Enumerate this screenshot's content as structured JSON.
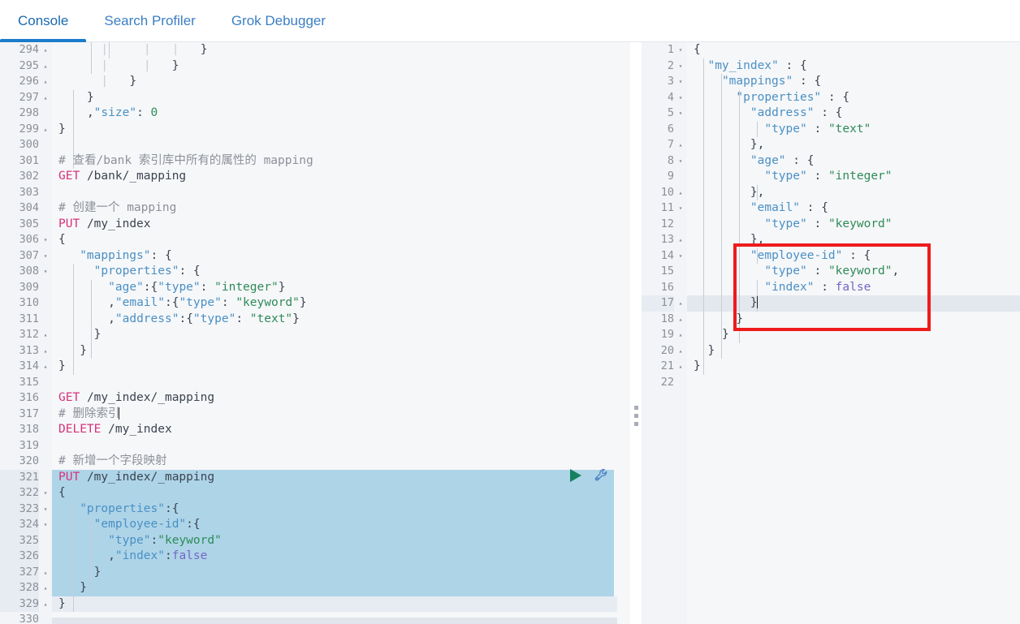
{
  "tabs": [
    {
      "label": "Console",
      "active": true
    },
    {
      "label": "Search Profiler",
      "active": false
    },
    {
      "label": "Grok Debugger",
      "active": false
    }
  ],
  "colors": {
    "accent": "#1a7ccb",
    "tab_text": "#3b7fc4",
    "selection": "#aed4e8",
    "active_line": "#e7ecf2",
    "annotation_box": "#ee1c1c",
    "play_icon": "#16805f",
    "wrench_icon": "#4a7fc1",
    "method_keyword": "#d6337b",
    "string": "#2e8b57",
    "key": "#4a90c4",
    "boolean": "#7566c4",
    "comment": "#8c9099",
    "gutter_text": "#8a9099"
  },
  "left_editor": {
    "name": "console-request-editor",
    "first_line": 294,
    "selected_lines": [
      321,
      322,
      323,
      324,
      325,
      326,
      327,
      328
    ],
    "active_line": 329,
    "lines": [
      {
        "n": 294,
        "fold": "up",
        "text": "      |     |   |   }"
      },
      {
        "n": 295,
        "fold": "up",
        "text": "      |     |   }"
      },
      {
        "n": 296,
        "fold": "up",
        "text": "      |   }"
      },
      {
        "n": 297,
        "fold": "up",
        "text": "    }"
      },
      {
        "n": 298,
        "fold": "",
        "text": "    ,\"size\": 0"
      },
      {
        "n": 299,
        "fold": "up",
        "text": "}"
      },
      {
        "n": 300,
        "fold": "",
        "text": ""
      },
      {
        "n": 301,
        "fold": "",
        "text": "# 查看/bank 索引库中所有的属性的 mapping"
      },
      {
        "n": 302,
        "fold": "",
        "text": "GET /bank/_mapping"
      },
      {
        "n": 303,
        "fold": "",
        "text": ""
      },
      {
        "n": 304,
        "fold": "",
        "text": "# 创建一个 mapping"
      },
      {
        "n": 305,
        "fold": "",
        "text": "PUT /my_index"
      },
      {
        "n": 306,
        "fold": "down",
        "text": "{"
      },
      {
        "n": 307,
        "fold": "down",
        "text": "   \"mappings\": {"
      },
      {
        "n": 308,
        "fold": "down",
        "text": "     \"properties\": {"
      },
      {
        "n": 309,
        "fold": "",
        "text": "       \"age\":{\"type\": \"integer\"}"
      },
      {
        "n": 310,
        "fold": "",
        "text": "       ,\"email\":{\"type\": \"keyword\"}"
      },
      {
        "n": 311,
        "fold": "",
        "text": "       ,\"address\":{\"type\": \"text\"}"
      },
      {
        "n": 312,
        "fold": "up",
        "text": "     }"
      },
      {
        "n": 313,
        "fold": "up",
        "text": "   }"
      },
      {
        "n": 314,
        "fold": "up",
        "text": "}"
      },
      {
        "n": 315,
        "fold": "",
        "text": ""
      },
      {
        "n": 316,
        "fold": "",
        "text": "GET /my_index/_mapping"
      },
      {
        "n": 317,
        "fold": "",
        "text": "# 删除索引"
      },
      {
        "n": 318,
        "fold": "",
        "text": "DELETE /my_index"
      },
      {
        "n": 319,
        "fold": "",
        "text": ""
      },
      {
        "n": 320,
        "fold": "",
        "text": "# 新增一个字段映射"
      },
      {
        "n": 321,
        "fold": "",
        "text": "PUT /my_index/_mapping"
      },
      {
        "n": 322,
        "fold": "down",
        "text": "{"
      },
      {
        "n": 323,
        "fold": "down",
        "text": "   \"properties\":{"
      },
      {
        "n": 324,
        "fold": "down",
        "text": "     \"employee-id\":{"
      },
      {
        "n": 325,
        "fold": "",
        "text": "       \"type\":\"keyword\""
      },
      {
        "n": 326,
        "fold": "",
        "text": "       ,\"index\":false"
      },
      {
        "n": 327,
        "fold": "up",
        "text": "     }"
      },
      {
        "n": 328,
        "fold": "up",
        "text": "   }"
      },
      {
        "n": 329,
        "fold": "up",
        "text": "}"
      },
      {
        "n": 330,
        "fold": "",
        "text": ""
      }
    ],
    "run_button": {
      "name": "run-request-play-button",
      "icon": "play-icon"
    },
    "wrench_button": {
      "name": "request-options-wrench-button",
      "icon": "wrench-icon"
    }
  },
  "right_editor": {
    "name": "console-response-viewer",
    "first_line": 1,
    "active_line": 17,
    "lines": [
      {
        "n": 1,
        "fold": "down",
        "text": "{"
      },
      {
        "n": 2,
        "fold": "down",
        "text": "  \"my_index\" : {"
      },
      {
        "n": 3,
        "fold": "down",
        "text": "    \"mappings\" : {"
      },
      {
        "n": 4,
        "fold": "down",
        "text": "      \"properties\" : {"
      },
      {
        "n": 5,
        "fold": "down",
        "text": "        \"address\" : {"
      },
      {
        "n": 6,
        "fold": "",
        "text": "          \"type\" : \"text\""
      },
      {
        "n": 7,
        "fold": "up",
        "text": "        },"
      },
      {
        "n": 8,
        "fold": "down",
        "text": "        \"age\" : {"
      },
      {
        "n": 9,
        "fold": "",
        "text": "          \"type\" : \"integer\""
      },
      {
        "n": 10,
        "fold": "up",
        "text": "        },"
      },
      {
        "n": 11,
        "fold": "down",
        "text": "        \"email\" : {"
      },
      {
        "n": 12,
        "fold": "",
        "text": "          \"type\" : \"keyword\""
      },
      {
        "n": 13,
        "fold": "up",
        "text": "        },"
      },
      {
        "n": 14,
        "fold": "down",
        "text": "        \"employee-id\" : {"
      },
      {
        "n": 15,
        "fold": "",
        "text": "          \"type\" : \"keyword\","
      },
      {
        "n": 16,
        "fold": "",
        "text": "          \"index\" : false"
      },
      {
        "n": 17,
        "fold": "up",
        "text": "        }"
      },
      {
        "n": 18,
        "fold": "up",
        "text": "      }"
      },
      {
        "n": 19,
        "fold": "up",
        "text": "    }"
      },
      {
        "n": 20,
        "fold": "up",
        "text": "  }"
      },
      {
        "n": 21,
        "fold": "up",
        "text": "}"
      },
      {
        "n": 22,
        "fold": "",
        "text": ""
      }
    ]
  },
  "annotation": {
    "name": "employee-id-highlight-box",
    "shape": "rectangle",
    "color": "#ee1c1c",
    "covers_lines": [
      13,
      14,
      15,
      16,
      17,
      18
    ]
  },
  "pane_divider": {
    "name": "pane-resize-handle",
    "dots": 3
  }
}
